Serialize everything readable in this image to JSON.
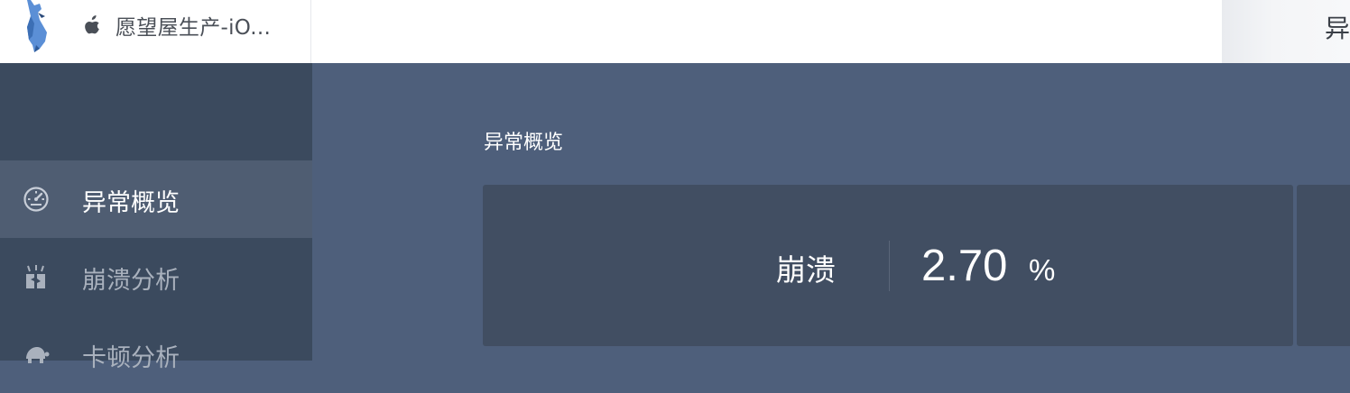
{
  "header": {
    "app_name": "愿望屋生产-iO...",
    "tab_label": "异"
  },
  "sidebar": {
    "items": [
      {
        "label": "异常概览",
        "icon": "gauge-icon",
        "active": true
      },
      {
        "label": "崩溃分析",
        "icon": "crash-icon",
        "active": false
      },
      {
        "label": "卡顿分析",
        "icon": "turtle-icon",
        "active": false
      }
    ]
  },
  "main": {
    "section_title": "异常概览",
    "metric": {
      "label": "崩溃",
      "value": "2.70",
      "unit": "%"
    }
  },
  "colors": {
    "sidebar_bg": "#3b4a5e",
    "sidebar_active_bg": "#4f5d72",
    "main_bg": "#4e5f7b",
    "card_bg": "#414e62",
    "logo_blue": "#5b8fd6"
  }
}
